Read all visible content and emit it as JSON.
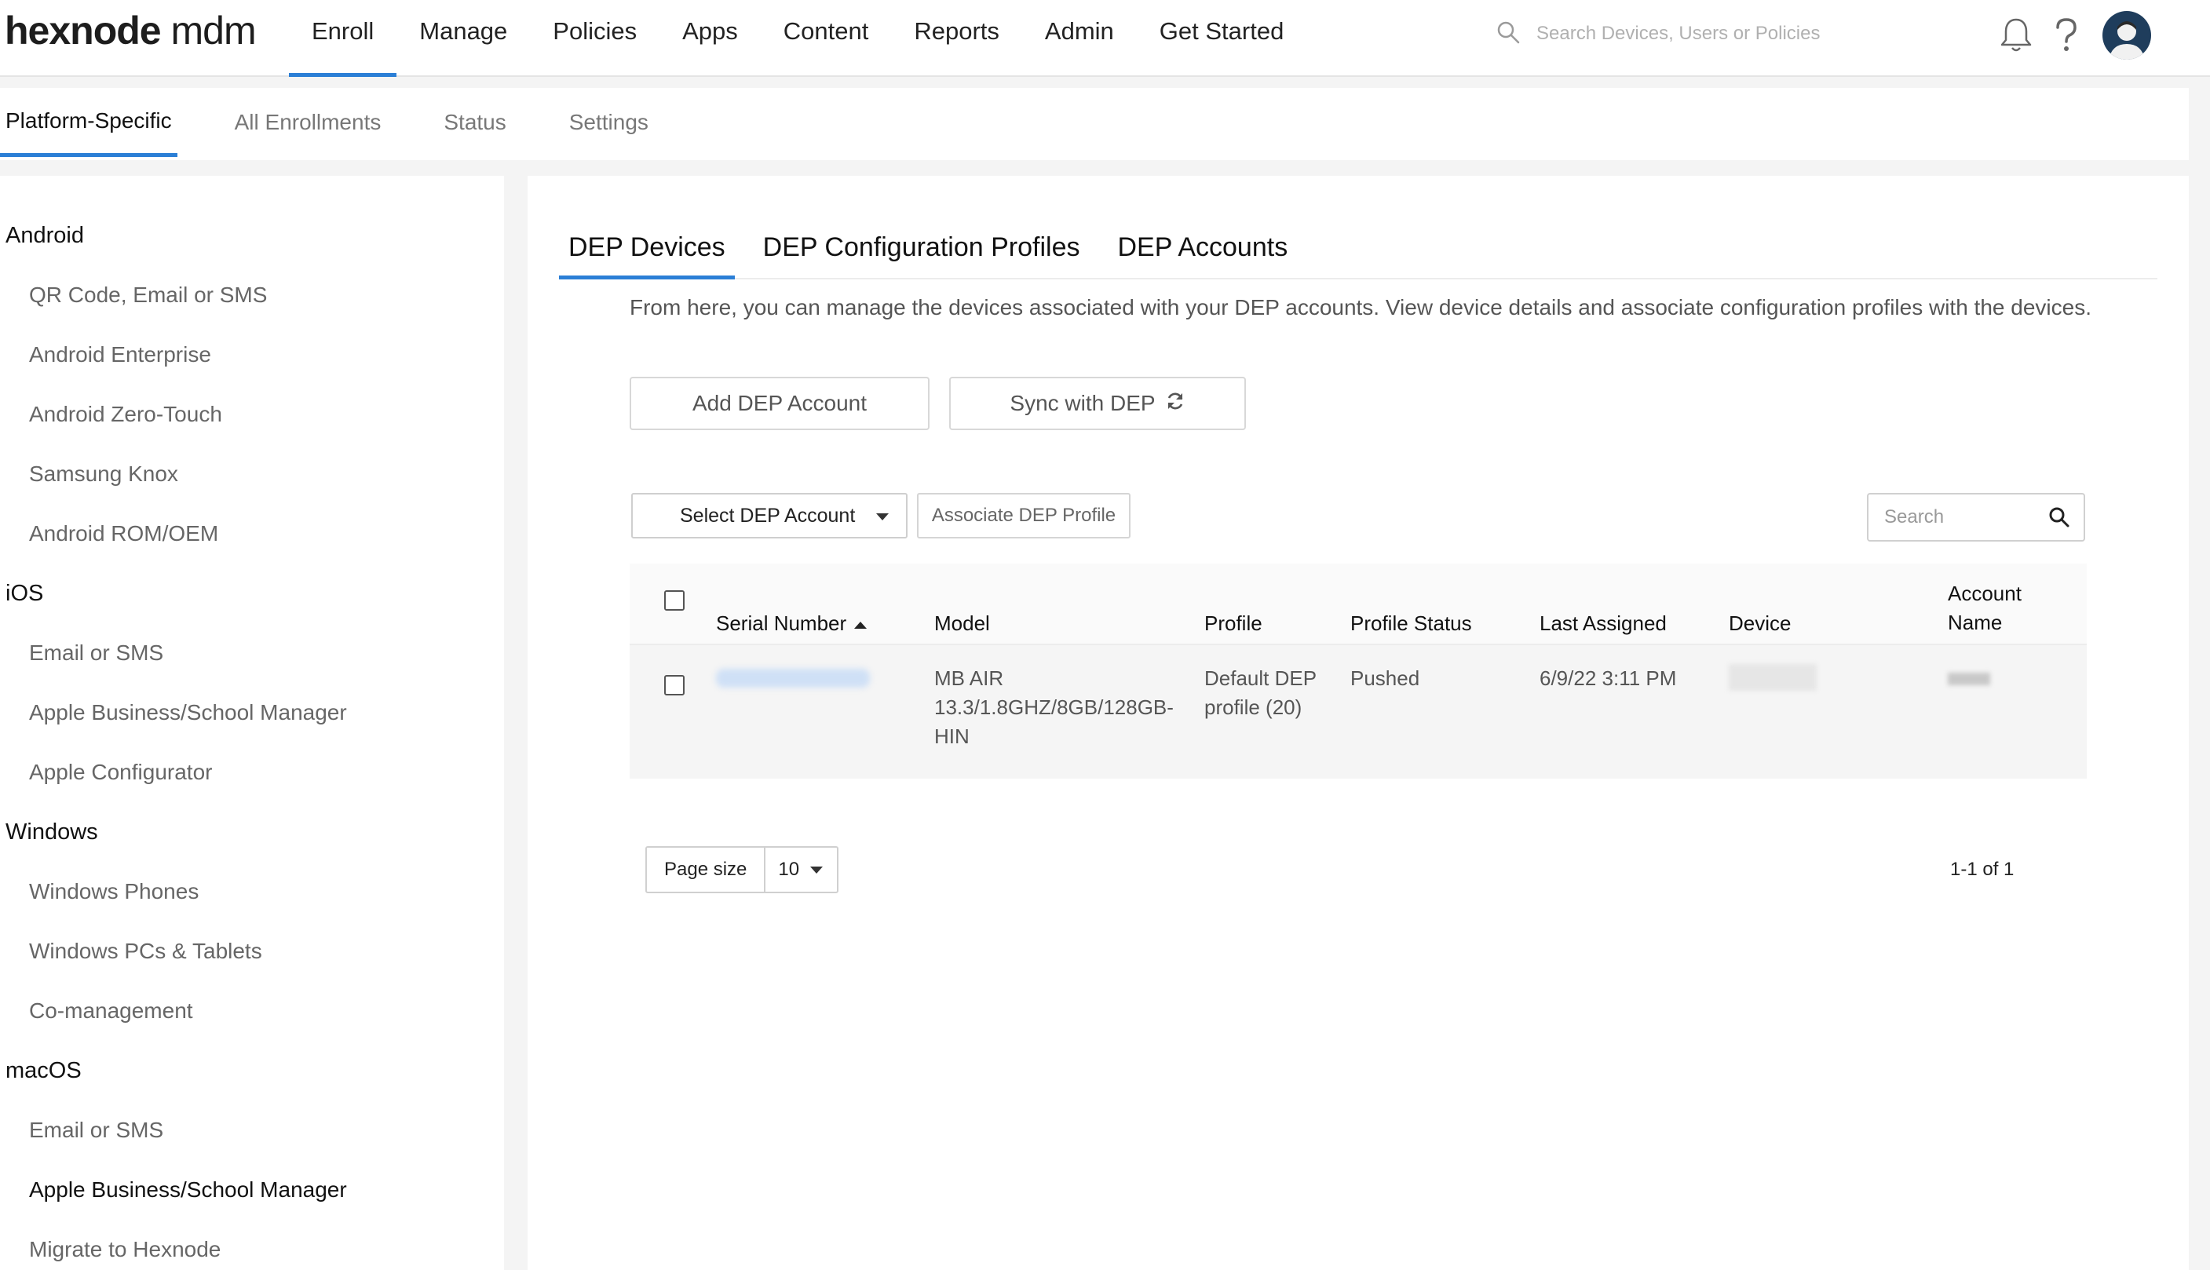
{
  "app": {
    "logo_brand": "hexnode",
    "logo_suffix": "mdm"
  },
  "nav": {
    "items": [
      {
        "label": "Enroll",
        "active": true
      },
      {
        "label": "Manage"
      },
      {
        "label": "Policies"
      },
      {
        "label": "Apps"
      },
      {
        "label": "Content"
      },
      {
        "label": "Reports"
      },
      {
        "label": "Admin"
      },
      {
        "label": "Get Started"
      }
    ],
    "search_placeholder": "Search Devices, Users or Policies"
  },
  "subtabs": [
    {
      "label": "Platform-Specific",
      "active": true
    },
    {
      "label": "All Enrollments"
    },
    {
      "label": "Status"
    },
    {
      "label": "Settings"
    }
  ],
  "sidebar": {
    "groups": [
      {
        "label": "Android",
        "items": [
          "QR Code, Email or SMS",
          "Android Enterprise",
          "Android Zero-Touch",
          "Samsung Knox",
          "Android ROM/OEM"
        ]
      },
      {
        "label": "iOS",
        "items": [
          "Email or SMS",
          "Apple Business/School Manager",
          "Apple Configurator"
        ]
      },
      {
        "label": "Windows",
        "items": [
          "Windows Phones",
          "Windows PCs & Tablets",
          "Co-management"
        ]
      },
      {
        "label": "macOS",
        "items": [
          "Email or SMS",
          "Apple Business/School Manager",
          "Migrate to Hexnode"
        ]
      }
    ],
    "current": "macOS / Apple Business/School Manager"
  },
  "main": {
    "tabs": [
      {
        "label": "DEP Devices",
        "active": true
      },
      {
        "label": "DEP Configuration Profiles"
      },
      {
        "label": "DEP Accounts"
      }
    ],
    "description": "From here, you can manage the devices associated with your DEP accounts. View device details and associate configuration profiles with the devices.",
    "add_account_label": "Add DEP Account",
    "sync_label": "Sync with DEP",
    "select_account_label": "Select DEP Account",
    "associate_label": "Associate DEP Profile",
    "search_placeholder": "Search",
    "table": {
      "headers": {
        "serial": "Serial Number",
        "model": "Model",
        "profile": "Profile",
        "profile_status": "Profile Status",
        "last_assigned": "Last Assigned",
        "device": "Device",
        "account_line1": "Account",
        "account_line2": "Name"
      },
      "rows": [
        {
          "model_l1": "MB AIR",
          "model_l2": "13.3/1.8GHZ/8GB/128GB-",
          "model_l3": "HIN",
          "profile_l1": "Default DEP",
          "profile_l2": "profile (20)",
          "profile_status": "Pushed",
          "last_assigned": "6/9/22 3:11 PM"
        }
      ]
    },
    "pagination": {
      "page_size_label": "Page size",
      "page_size": "10",
      "range": "1-1 of 1"
    }
  },
  "colors": {
    "accent": "#2b7fd6",
    "avatar_bg": "#1f3d5c"
  }
}
